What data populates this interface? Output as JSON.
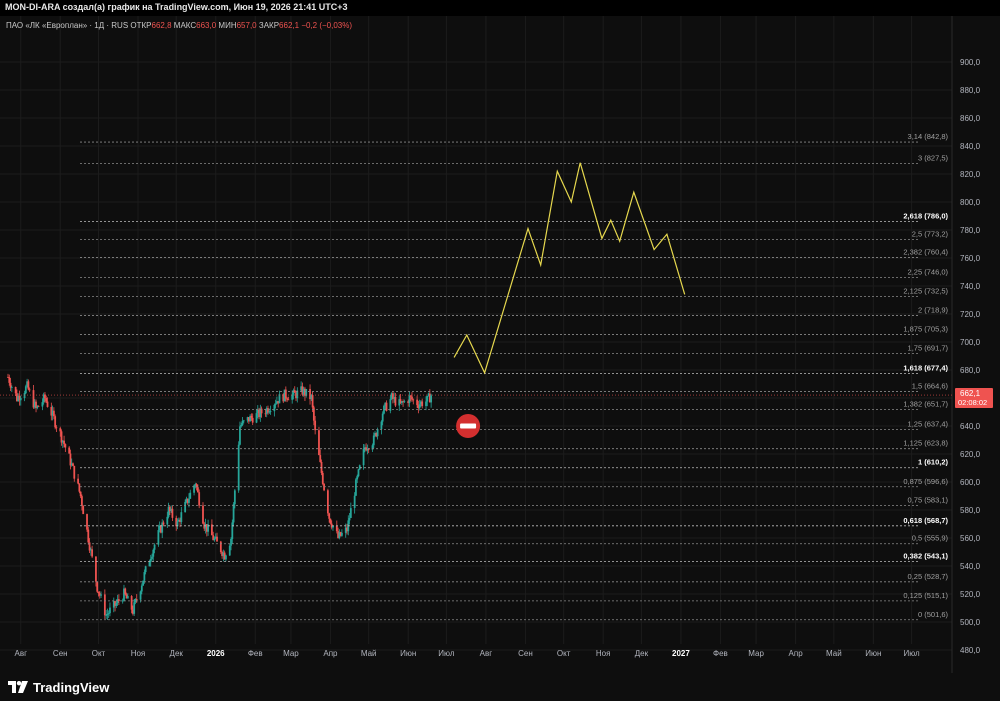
{
  "header": {
    "publish_line": "MON-DI-ARA создал(а) график на TradingView.com, Июн 19, 2026 21:41 UTC+3"
  },
  "legend": {
    "symbol": "ПАО «ЛК «Европлан» · 1Д · RUS",
    "open_label": "ОТКР",
    "open_value": "662,8",
    "high_label": "МАКС",
    "high_value": "663,0",
    "low_label": "МИН",
    "low_value": "657,0",
    "close_label": "ЗАКР",
    "close_value": "662,1",
    "change": "−0,2 (−0,03%)"
  },
  "footer": {
    "brand": "TradingView"
  },
  "colors": {
    "background": "#0e0e0e",
    "up": "#26a69a",
    "down": "#ef5350",
    "projection": "#e6d84e",
    "grid": "#1c1c1c",
    "fib_line": "#8a8a8a"
  },
  "chart_data": {
    "type": "candlestick",
    "title": "",
    "y_range": [
      475,
      905
    ],
    "y_ticks": [
      480,
      500,
      520,
      540,
      560,
      580,
      600,
      620,
      640,
      660,
      680,
      700,
      720,
      740,
      760,
      780,
      800,
      820,
      840,
      860,
      880,
      900
    ],
    "y_tick_labels": [
      "480,0",
      "500,0",
      "520,0",
      "540,0",
      "560,0",
      "580,0",
      "600,0",
      "620,0",
      "640,0",
      "660,0",
      "680,0",
      "700,0",
      "720,0",
      "740,0",
      "760,0",
      "780,0",
      "800,0",
      "820,0",
      "840,0",
      "860,0",
      "880,0",
      "900,0"
    ],
    "x_labels": [
      "Авг",
      "Сен",
      "Окт",
      "Ноя",
      "Дек",
      "2026",
      "Фев",
      "Мар",
      "Апр",
      "Май",
      "Июн",
      "Июл",
      "Авг",
      "Сен",
      "Окт",
      "Ноя",
      "Дек",
      "2027",
      "Фев",
      "Мар",
      "Апр",
      "Май",
      "Июн",
      "Июл"
    ],
    "x_start": "2025-07-22",
    "x_end": "2027-07-28",
    "last_price": {
      "value": 662.1,
      "label": "662,1",
      "countdown": "02:08:02"
    },
    "price_path": [
      [
        "2025-07-22",
        675
      ],
      [
        "2025-07-29",
        660
      ],
      [
        "2025-08-06",
        668
      ],
      [
        "2025-08-13",
        652
      ],
      [
        "2025-08-20",
        660
      ],
      [
        "2025-08-27",
        645
      ],
      [
        "2025-09-03",
        630
      ],
      [
        "2025-09-10",
        612
      ],
      [
        "2025-09-17",
        590
      ],
      [
        "2025-09-24",
        555
      ],
      [
        "2025-09-30",
        525
      ],
      [
        "2025-10-07",
        505
      ],
      [
        "2025-10-14",
        512
      ],
      [
        "2025-10-21",
        520
      ],
      [
        "2025-10-28",
        508
      ],
      [
        "2025-11-04",
        528
      ],
      [
        "2025-11-11",
        548
      ],
      [
        "2025-11-18",
        565
      ],
      [
        "2025-11-25",
        580
      ],
      [
        "2025-12-02",
        570
      ],
      [
        "2025-12-09",
        585
      ],
      [
        "2025-12-16",
        600
      ],
      [
        "2025-12-23",
        570
      ],
      [
        "2025-12-30",
        560
      ],
      [
        "2026-01-08",
        548
      ],
      [
        "2026-01-13",
        560
      ],
      [
        "2026-01-20",
        640
      ],
      [
        "2026-01-27",
        645
      ],
      [
        "2026-02-03",
        648
      ],
      [
        "2026-02-10",
        652
      ],
      [
        "2026-02-17",
        658
      ],
      [
        "2026-02-24",
        662
      ],
      [
        "2026-03-03",
        662
      ],
      [
        "2026-03-10",
        665
      ],
      [
        "2026-03-17",
        660
      ],
      [
        "2026-03-20",
        635
      ],
      [
        "2026-03-24",
        612
      ],
      [
        "2026-03-31",
        575
      ],
      [
        "2026-04-07",
        560
      ],
      [
        "2026-04-14",
        566
      ],
      [
        "2026-04-21",
        598
      ],
      [
        "2026-04-28",
        625
      ],
      [
        "2026-05-05",
        630
      ],
      [
        "2026-05-12",
        650
      ],
      [
        "2026-05-19",
        660
      ],
      [
        "2026-05-26",
        655
      ],
      [
        "2026-06-02",
        660
      ],
      [
        "2026-06-09",
        656
      ],
      [
        "2026-06-16",
        658
      ],
      [
        "2026-06-19",
        662.1
      ]
    ],
    "projection_path": [
      [
        "2026-07-07",
        689
      ],
      [
        "2026-07-17",
        705
      ],
      [
        "2026-07-31",
        678
      ],
      [
        "2026-09-03",
        781
      ],
      [
        "2026-09-13",
        755
      ],
      [
        "2026-09-26",
        822
      ],
      [
        "2026-10-07",
        800
      ],
      [
        "2026-10-14",
        828
      ],
      [
        "2026-10-31",
        774
      ],
      [
        "2026-11-07",
        787
      ],
      [
        "2026-11-14",
        772
      ],
      [
        "2026-11-25",
        807
      ],
      [
        "2026-12-11",
        766
      ],
      [
        "2026-12-21",
        777
      ],
      [
        "2027-01-04",
        734
      ]
    ],
    "fib_levels": [
      {
        "ratio": "0",
        "label": "0 (501,6)",
        "value": 501.6,
        "emphasis": false
      },
      {
        "ratio": "0,125",
        "label": "0,125 (515,1)",
        "value": 515.1,
        "emphasis": false
      },
      {
        "ratio": "0,25",
        "label": "0,25 (528,7)",
        "value": 528.7,
        "emphasis": false
      },
      {
        "ratio": "0,382",
        "label": "0,382 (543,1)",
        "value": 543.1,
        "emphasis": true
      },
      {
        "ratio": "0,5",
        "label": "0,5 (555,9)",
        "value": 555.9,
        "emphasis": false
      },
      {
        "ratio": "0,618",
        "label": "0,618 (568,7)",
        "value": 568.7,
        "emphasis": true
      },
      {
        "ratio": "0,75",
        "label": "0,75 (583,1)",
        "value": 583.1,
        "emphasis": false
      },
      {
        "ratio": "0,875",
        "label": "0,875 (596,6)",
        "value": 596.6,
        "emphasis": false
      },
      {
        "ratio": "1",
        "label": "1 (610,2)",
        "value": 610.2,
        "emphasis": true
      },
      {
        "ratio": "1,125",
        "label": "1,125 (623,8)",
        "value": 623.8,
        "emphasis": false
      },
      {
        "ratio": "1,25",
        "label": "1,25 (637,4)",
        "value": 637.4,
        "emphasis": false
      },
      {
        "ratio": "1,382",
        "label": "1,382 (651,7)",
        "value": 651.7,
        "emphasis": false
      },
      {
        "ratio": "1,5",
        "label": "1,5 (664,6)",
        "value": 664.6,
        "emphasis": false
      },
      {
        "ratio": "1,618",
        "label": "1,618 (677,4)",
        "value": 677.4,
        "emphasis": true
      },
      {
        "ratio": "1,75",
        "label": "1,75 (691,7)",
        "value": 691.7,
        "emphasis": false
      },
      {
        "ratio": "1,875",
        "label": "1,875 (705,3)",
        "value": 705.3,
        "emphasis": false
      },
      {
        "ratio": "2",
        "label": "2 (718,9)",
        "value": 718.9,
        "emphasis": false
      },
      {
        "ratio": "2,125",
        "label": "2,125 (732,5)",
        "value": 732.5,
        "emphasis": false
      },
      {
        "ratio": "2,25",
        "label": "2,25 (746,0)",
        "value": 746.0,
        "emphasis": false
      },
      {
        "ratio": "2,382",
        "label": "2,382 (760,4)",
        "value": 760.4,
        "emphasis": false
      },
      {
        "ratio": "2,5",
        "label": "2,5 (773,2)",
        "value": 773.2,
        "emphasis": false
      },
      {
        "ratio": "2,618",
        "label": "2,618 (786,0)",
        "value": 786.0,
        "emphasis": true
      },
      {
        "ratio": "3",
        "label": "3 (827,5)",
        "value": 827.5,
        "emphasis": false
      },
      {
        "ratio": "3,14",
        "label": "3,14 (842,8)",
        "value": 842.8,
        "emphasis": false
      }
    ],
    "marker": {
      "date": "2026-07-18",
      "value": 640,
      "icon": "no-entry-icon"
    }
  }
}
